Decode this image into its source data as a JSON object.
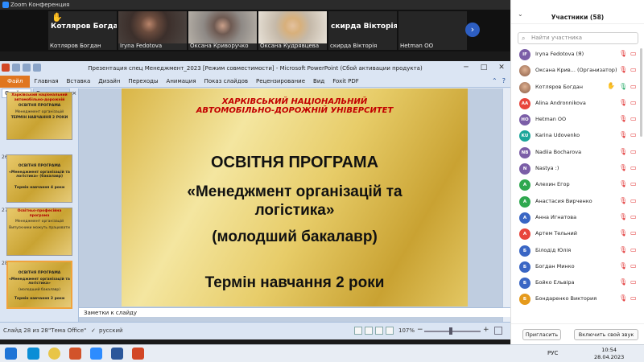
{
  "zoom": {
    "window_title": "Zoom Конференция",
    "tiles": [
      {
        "label": "Котляров Богдан",
        "big": "Котляров Богдан",
        "hand": true
      },
      {
        "label": "Iryna Fedotova",
        "big": ""
      },
      {
        "label": "Оксана Криворучко",
        "big": ""
      },
      {
        "label": "Оксана Кудрявцева",
        "big": ""
      },
      {
        "label": "скирда Вікторія",
        "big": "скирда Вікторія"
      },
      {
        "label": "Hetman OO",
        "big": ""
      }
    ],
    "next_icon": "chevron-right-icon"
  },
  "ppt": {
    "title": "Презентация спец Менеджмент_2023 [Режим совместимости] - Microsoft PowerPoint (Сбой активации продукта)",
    "file_tab": "Файл",
    "tabs": [
      "Главная",
      "Вставка",
      "Дизайн",
      "Переходы",
      "Анимация",
      "Показ слайдов",
      "Рецензирование",
      "Вид",
      "Foxit PDF"
    ],
    "panel_tabs": [
      "Слайды",
      "Структура"
    ],
    "panel_close": "×",
    "thumbs": [
      {
        "num": "",
        "lines": [
          "Харківський національний автомобільно-дорожній",
          "ОСВІТНЯ ПРОГРАМА",
          "Менеджмент організацій",
          "ТЕРМІН НАВЧАННЯ 2 РОКИ"
        ]
      },
      {
        "num": "26",
        "lines": [
          "ОСВІТНЯ ПРОГРАМА",
          "«Менеджмент організацій та логістика» (бакалавр)",
          "Термін навчання 4 роки"
        ]
      },
      {
        "num": "27",
        "lines": [
          "Освітньо-професійна програма",
          "Менеджмент організацій",
          "Випускники можуть працювати"
        ]
      },
      {
        "num": "28",
        "lines": [
          "ОСВІТНЯ ПРОГРАМА",
          "«Менеджмент організацій та логістика»",
          "(молодший бакалавр)",
          "Термін навчання 2 роки"
        ]
      }
    ],
    "slide": {
      "university_line1": "ХАРКІВСЬКИЙ НАЦІОНАЛЬНИЙ",
      "university_line2": "АВТОМОБІЛЬНО-ДОРОЖНІЙ УНІВЕРСИТЕТ",
      "heading": "ОСВІТНЯ ПРОГРАМА",
      "program_line1": "«Менеджмент організацій та",
      "program_line2": "логістика»",
      "degree": "(молодший бакалавр)",
      "duration": "Термін навчання 2 роки"
    },
    "notes_placeholder": "Заметки к слайду",
    "status": {
      "slide_of": "Слайд 28 из 28",
      "theme": "\"Тема Office\"",
      "language": "русский",
      "zoom_level": "107%",
      "minus": "−",
      "plus": "+"
    },
    "win_buttons": [
      "─",
      "□",
      "✕"
    ]
  },
  "participants": {
    "title": "Участники (58)",
    "search_placeholder": "Найти участника",
    "list": [
      {
        "initials": "IF",
        "name": "Iryna Fedotova (Я)",
        "color": "#7b5ea7",
        "mic": "off",
        "cam": "off"
      },
      {
        "initials": "",
        "name": "Оксана Крив... (Организатор)",
        "color": "#c88f6b",
        "mic": "off",
        "cam": "off",
        "photo": true
      },
      {
        "initials": "",
        "name": "Котляров Богдан",
        "color": "#c88f6b",
        "mic": "on",
        "cam": "off",
        "photo": true,
        "hand": true
      },
      {
        "initials": "AA",
        "name": "Alina Andronnikova",
        "color": "#e8453c",
        "mic": "off",
        "cam": "off"
      },
      {
        "initials": "HO",
        "name": "Hetman OO",
        "color": "#7b5ea7",
        "mic": "off",
        "cam": "off"
      },
      {
        "initials": "KU",
        "name": "Karina Udovenko",
        "color": "#1ca69a",
        "mic": "off",
        "cam": "off"
      },
      {
        "initials": "NB",
        "name": "Nadiia Bocharova",
        "color": "#7b5ea7",
        "mic": "off",
        "cam": "off"
      },
      {
        "initials": "N",
        "name": "Nastya :)",
        "color": "#7b5ea7",
        "mic": "off",
        "cam": "off"
      },
      {
        "initials": "A",
        "name": "Алехин Егор",
        "color": "#2fa84f",
        "mic": "off",
        "cam": "off"
      },
      {
        "initials": "A",
        "name": "Анастасия Вирченко",
        "color": "#2fa84f",
        "mic": "off",
        "cam": "off"
      },
      {
        "initials": "A",
        "name": "Анна Игнатова",
        "color": "#3a66c4",
        "mic": "off",
        "cam": "off"
      },
      {
        "initials": "A",
        "name": "Артем Тельний",
        "color": "#e8453c",
        "mic": "off",
        "cam": "off"
      },
      {
        "initials": "Б",
        "name": "Білодід Юлія",
        "color": "#3a66c4",
        "mic": "off",
        "cam": "off"
      },
      {
        "initials": "Б",
        "name": "Богдан Минко",
        "color": "#3a66c4",
        "mic": "off",
        "cam": "off"
      },
      {
        "initials": "Б",
        "name": "Бойко Ельвіра",
        "color": "#3a66c4",
        "mic": "off",
        "cam": "off"
      },
      {
        "initials": "Б",
        "name": "Бондаренко Виктория",
        "color": "#e59a1c",
        "mic": "off",
        "cam": "off"
      }
    ],
    "invite_label": "Пригласить",
    "unmute_label": "Включить свой звук"
  },
  "taskbar": {
    "tray_lang": "РУС",
    "time": "10:54",
    "date": "28.04.2023"
  }
}
